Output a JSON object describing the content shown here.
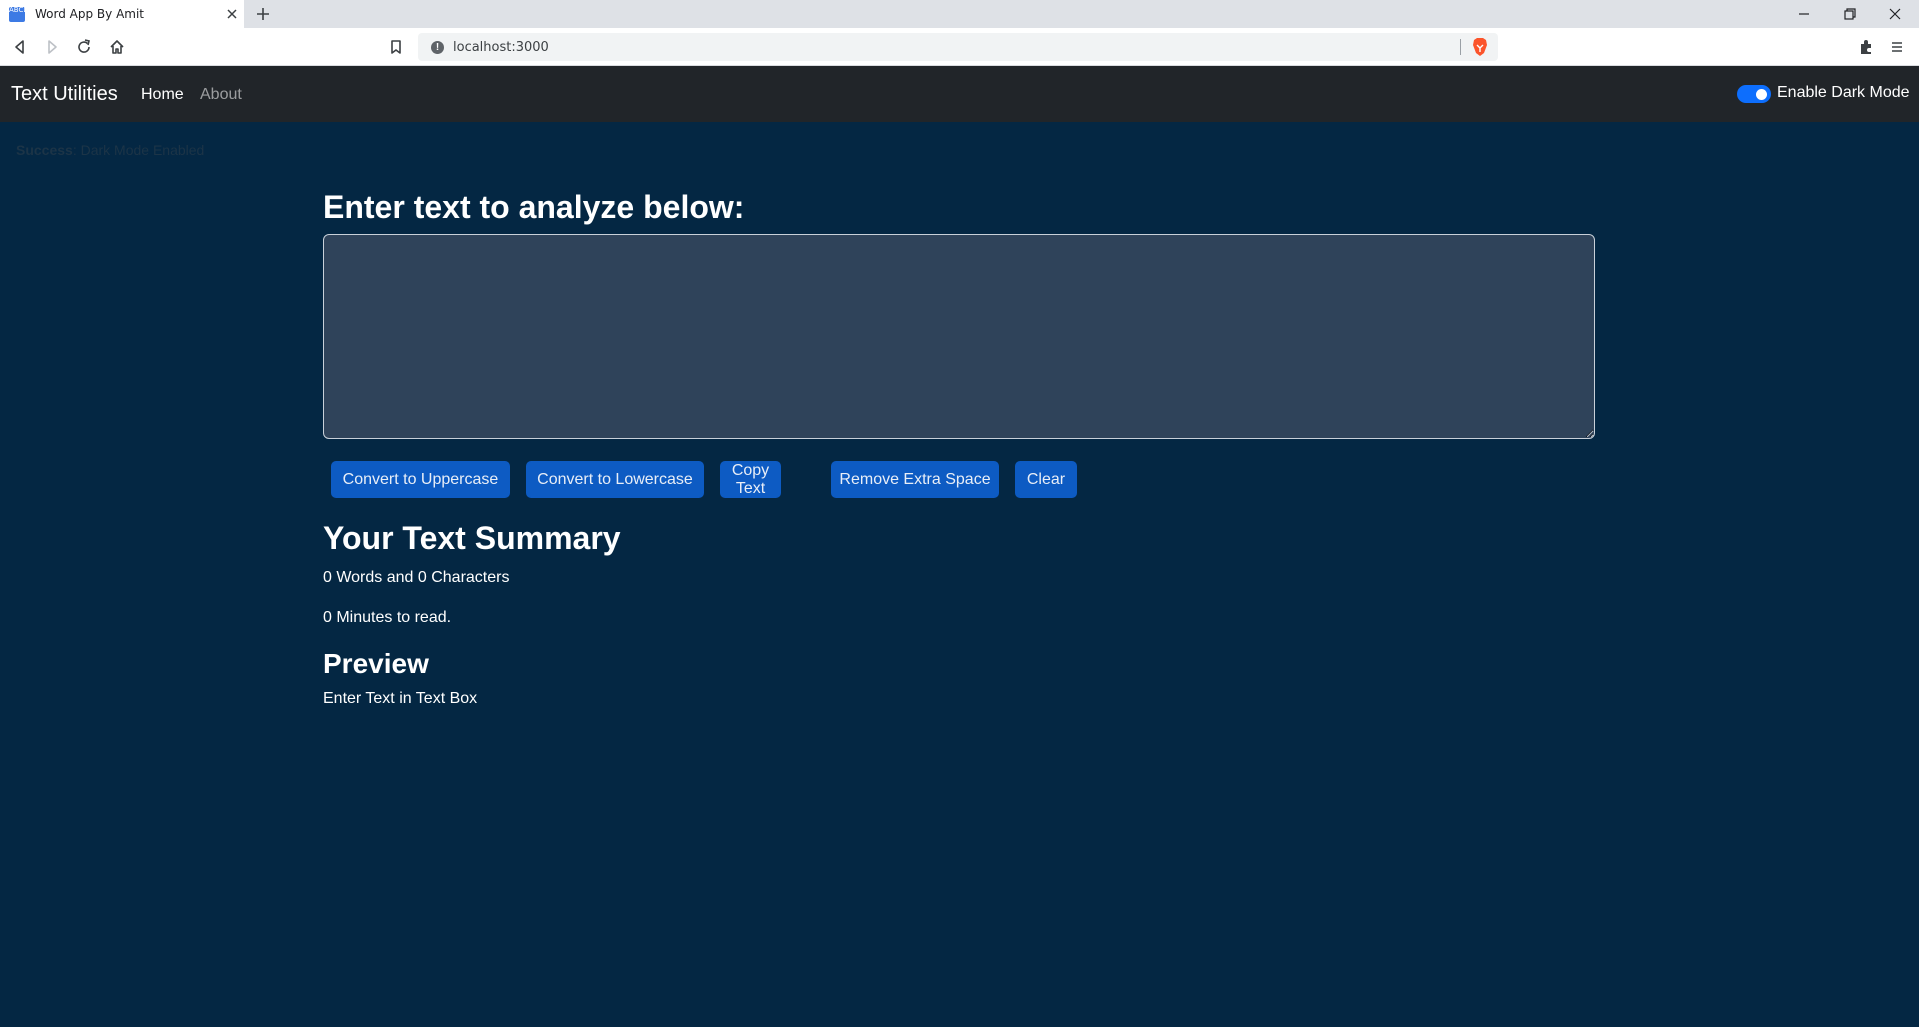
{
  "browser": {
    "tab_title": "Word App By Amit",
    "favicon_text": "ABCD",
    "url": "localhost:3000"
  },
  "navbar": {
    "brand": "Text Utilities",
    "links": [
      {
        "label": "Home",
        "active": true
      },
      {
        "label": "About",
        "active": false
      }
    ],
    "dark_mode_label": "Enable Dark Mode",
    "dark_mode_enabled": true
  },
  "alert": {
    "strong": "Success",
    "message": ": Dark Mode Enabled"
  },
  "main": {
    "heading": "Enter text to analyze below:",
    "textarea_value": "",
    "buttons": [
      {
        "label": "Convert to Uppercase"
      },
      {
        "label": "Convert to Lowercase"
      },
      {
        "label": "Copy Text"
      },
      {
        "label": "Remove Extra Space"
      },
      {
        "label": "Clear"
      }
    ]
  },
  "summary": {
    "title": "Your Text Summary",
    "words_chars": "0 Words and 0 Characters",
    "read_time": "0 Minutes to read."
  },
  "preview": {
    "title": "Preview",
    "text": "Enter Text in Text Box"
  },
  "colors": {
    "background": "#042743",
    "navbar": "#212529",
    "button": "#0d5bc3",
    "textarea": "#2f435a",
    "switch": "#0d6efd"
  }
}
